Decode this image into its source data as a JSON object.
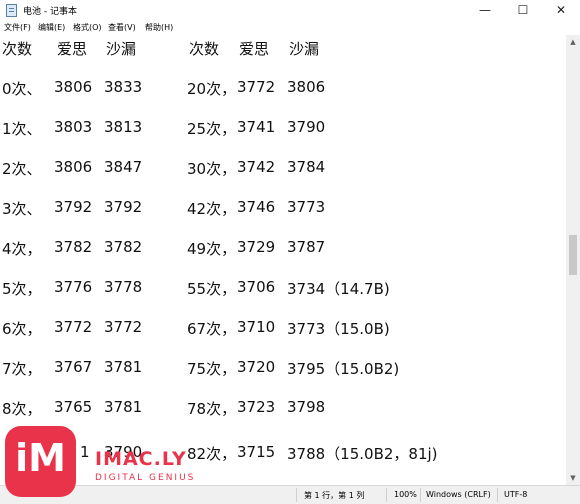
{
  "window": {
    "title": "电池 - 记事本",
    "minimize": "—",
    "maximize": "☐",
    "close": "✕"
  },
  "menu": [
    "文件(F)",
    "编辑(E)",
    "格式(O)",
    "查看(V)",
    "帮助(H)"
  ],
  "editor": {
    "rows": [
      [
        "次数",
        "爱思",
        "沙漏",
        "次数",
        "爱思",
        "沙漏"
      ],
      [
        "0次、",
        "3806",
        "3833",
        "20次，",
        "3772",
        "3806"
      ],
      [
        "1次、",
        "3803",
        "3813",
        "25次，",
        "3741",
        "3790"
      ],
      [
        "2次、",
        "3806",
        "3847",
        "30次，",
        "3742",
        "3784"
      ],
      [
        "3次、",
        "3792",
        "3792",
        "42次，",
        "3746",
        "3773"
      ],
      [
        "4次，",
        "3782",
        "3782",
        "49次，",
        "3729",
        "3787"
      ],
      [
        "5次，",
        "3776",
        "3778",
        "55次，",
        "3706",
        "3734（14.7B)"
      ],
      [
        "6次，",
        "3772",
        "3772",
        "67次，",
        "3710",
        "3773（15.0B)"
      ],
      [
        "7次，",
        "3767",
        "3781",
        "75次，",
        "3720",
        "3795（15.0B2)"
      ],
      [
        "8次，",
        "3765",
        "3781",
        "78次，",
        "3723",
        "3798"
      ],
      [
        "",
        "1",
        "3790",
        "82次，",
        "3715",
        "3788（15.0B2，81j)"
      ]
    ]
  },
  "statusbar": {
    "position": "第 1 行，第 1 列",
    "zoom": "100%",
    "line_ending": "Windows (CRLF)",
    "encoding": "UTF-8"
  },
  "watermark": {
    "logo": "iM",
    "name": "IMAC.LY",
    "tagline": "DIGITAL GENIUS"
  }
}
